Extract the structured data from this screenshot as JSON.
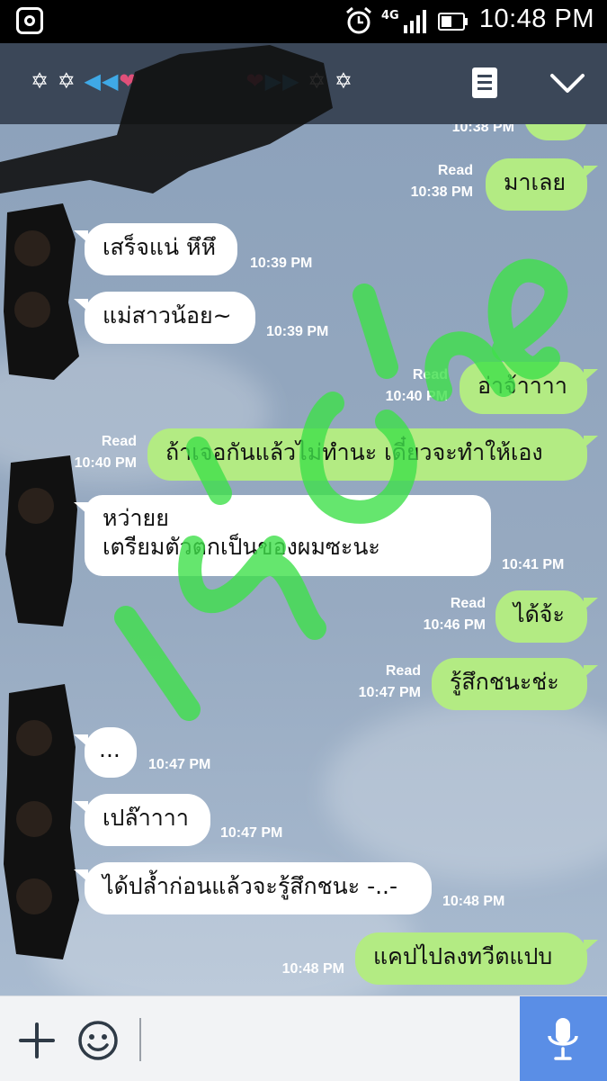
{
  "status_bar": {
    "network": "4G",
    "time": "10:48 PM"
  },
  "header": {
    "title_left": "✡ ✡ ",
    "title_arrows_left": "◀◀",
    "title_heart_left": "❤",
    "title_heart_right": "❤",
    "title_arrows_right": "▶▶",
    "title_right": " ✡ ✡"
  },
  "messages": [
    {
      "side": "out",
      "text": "",
      "time": "10:38 PM",
      "read": ""
    },
    {
      "side": "out",
      "text": "มาเลย",
      "time": "10:38 PM",
      "read": "Read"
    },
    {
      "side": "in",
      "text": "เสร็จแน่ หึหึ",
      "time": "10:39 PM"
    },
    {
      "side": "in",
      "text": "แม่สาวน้อย~",
      "time": "10:39 PM"
    },
    {
      "side": "out",
      "text": "อ่าจ้าาาา",
      "time": "10:40 PM",
      "read": "Read"
    },
    {
      "side": "out",
      "text": "ถ้าเจอกันแล้วไม่ทำนะ เดี๋ยวจะทำให้เอง",
      "time": "10:40 PM",
      "read": "Read"
    },
    {
      "side": "in",
      "text_line1": "หว่ายย",
      "text_line2": "เตรียมตัวตกเป็นของผมซะนะ",
      "time": "10:41 PM"
    },
    {
      "side": "out",
      "text": "ได้จ้ะ",
      "time": "10:46 PM",
      "read": "Read"
    },
    {
      "side": "out",
      "text": "รู้สึกชนะช่ะ",
      "time": "10:47 PM",
      "read": "Read"
    },
    {
      "side": "in",
      "text": "...",
      "time": "10:47 PM"
    },
    {
      "side": "in",
      "text": "เปล๊าาาา",
      "time": "10:47 PM"
    },
    {
      "side": "in",
      "text": "ได้ปล้ำก่อนแล้วจะรู้สึกชนะ -..-",
      "time": "10:48 PM"
    },
    {
      "side": "out",
      "text": "แคปไปลงทวีตแปบ",
      "time": "10:48 PM",
      "read": ""
    }
  ],
  "watermark": {
    "text": "แค่ไหว",
    "color": "#3ee04a"
  },
  "colors": {
    "header_bg": "#3b4758",
    "outgoing_bubble": "#b3eb83",
    "incoming_bubble": "#ffffff",
    "mic_button": "#5a8ee6"
  },
  "icons": {
    "status_app": "record-icon",
    "alarm": "alarm-icon",
    "signal": "signal-icon",
    "battery": "battery-icon",
    "notes": "notes-icon",
    "collapse": "chevron-down-icon",
    "plus": "plus-icon",
    "emoji": "emoji-icon",
    "mic": "microphone-icon"
  }
}
